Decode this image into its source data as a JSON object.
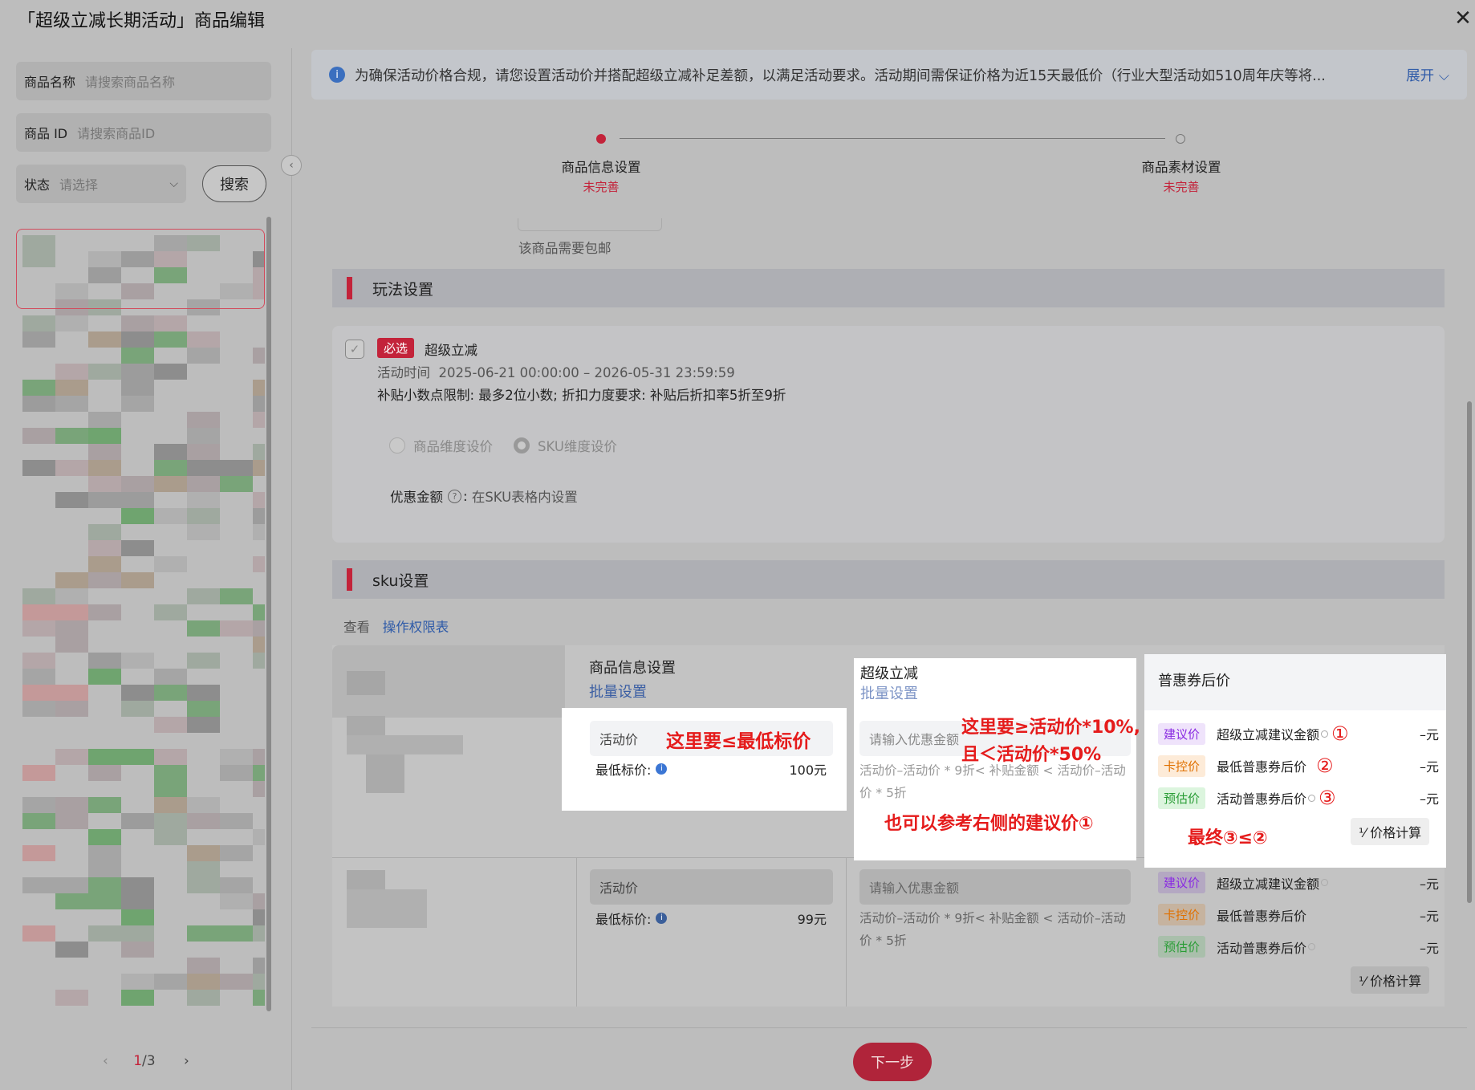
{
  "header": {
    "title": "「超级立减长期活动」商品编辑",
    "close_glyph": "✕"
  },
  "filters": {
    "name": {
      "label": "商品名称",
      "placeholder": "请搜索商品名称"
    },
    "id": {
      "label": "商品 ID",
      "placeholder": "请搜索商品ID"
    },
    "status": {
      "label": "状态",
      "placeholder": "请选择"
    },
    "search_label": "搜索"
  },
  "pager": {
    "prev": "‹",
    "current": "1",
    "total": "/3",
    "next": "›"
  },
  "notice": {
    "text": "为确保活动价格合规，请您设置活动价并搭配超级立减补足差额，以满足活动要求。活动期间需保证价格为近15天最低价（行业大型活动如510周年庆等将...",
    "expand": "展开 ⌵"
  },
  "steps": [
    {
      "label": "商品信息设置",
      "status": "未完善"
    },
    {
      "label": "商品素材设置",
      "status": "未完善"
    }
  ],
  "shipping_note": "该商品需要包邮",
  "play_section": {
    "title": "玩法设置",
    "required_badge": "必选",
    "name": "超级立减",
    "time_label": "活动时间",
    "time_value": "2025-06-21 00:00:00  –  2026-05-31 23:59:59",
    "rule": "补贴小数点限制: 最多2位小数; 折扣力度要求: 补贴后折扣率5折至9折",
    "options": [
      "商品维度设价",
      "SKU维度设价"
    ],
    "discount_label": "优惠金额",
    "discount_value": "在SKU表格内设置"
  },
  "sku_section": {
    "title": "sku设置",
    "view_label": "查看",
    "perm_link": "操作权限表",
    "col_info": "商品信息设置",
    "col_info_batch": "批量设置",
    "col_reduce": "超级立减",
    "col_reduce_batch": "批量设置",
    "col_coupon": "普惠券后价",
    "rows": [
      {
        "activity_price_label": "活动价",
        "min_price_label": "最低标价:",
        "min_price": "100元",
        "discount_placeholder": "请输入优惠金额",
        "discount_rule": "活动价–活动价 * 9折< 补贴金额 < 活动价–活动价 * 5折",
        "tags": [
          {
            "tag": "建议价",
            "name": "超级立减建议金额",
            "value": "–元",
            "mark": "①"
          },
          {
            "tag": "卡控价",
            "name": "最低普惠券后价",
            "value": "–元",
            "mark": "②"
          },
          {
            "tag": "预估价",
            "name": "活动普惠券后价",
            "value": "–元",
            "mark": "③"
          }
        ],
        "calc_label": "价格计算"
      },
      {
        "activity_price_label": "活动价",
        "min_price_label": "最低标价:",
        "min_price": "99元",
        "discount_placeholder": "请输入优惠金额",
        "discount_rule": "活动价–活动价 * 9折< 补贴金额 < 活动价–活动价 * 5折",
        "tags": [
          {
            "tag": "建议价",
            "name": "超级立减建议金额",
            "value": "–元"
          },
          {
            "tag": "卡控价",
            "name": "最低普惠券后价",
            "value": "–元"
          },
          {
            "tag": "预估价",
            "name": "活动普惠券后价",
            "value": "–元"
          }
        ],
        "calc_label": "价格计算"
      }
    ]
  },
  "annotations": {
    "a1": "这里要≤最低标价",
    "a2_line1": "这里要≥活动价*10%,",
    "a2_line2": "且＜活动价*50%",
    "a3": "也可以参考右侧的建议价①",
    "a4": "最终③≤②"
  },
  "footer": {
    "next_label": "下一步"
  },
  "colors": {
    "accent": "#c3233a",
    "link": "#2f5ba8",
    "annotation": "#e51b1b"
  }
}
